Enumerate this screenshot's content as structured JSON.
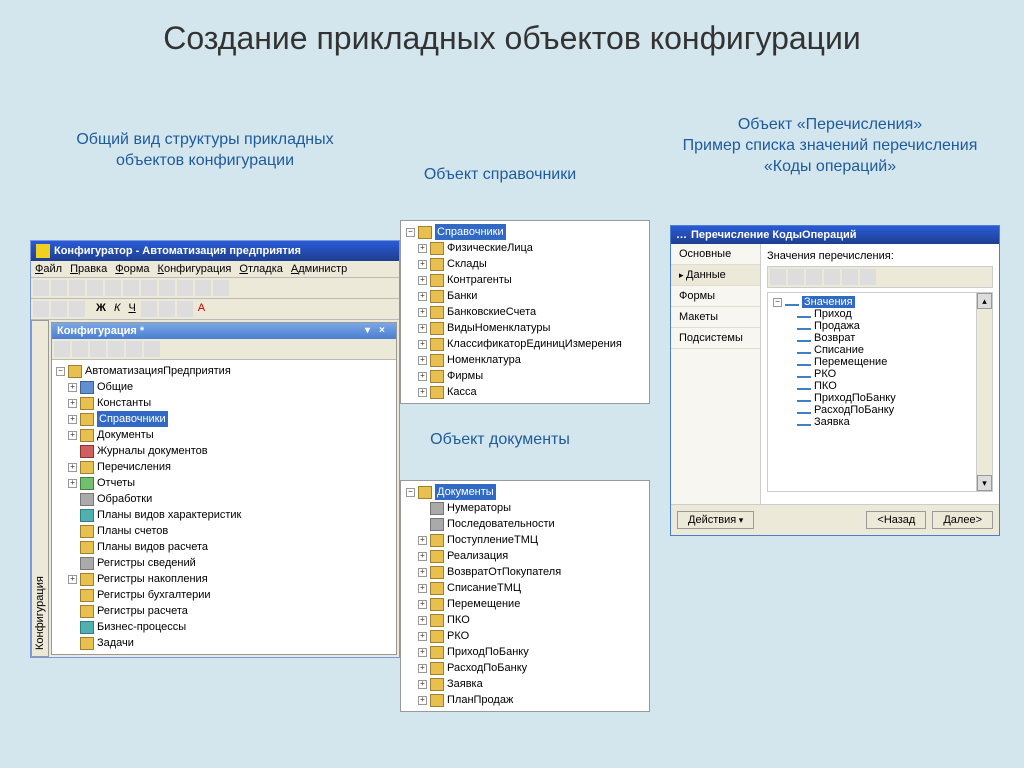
{
  "slide": {
    "title": "Создание прикладных объектов конфигурации",
    "caption1": "Общий вид структуры прикладных объектов конфигурации",
    "caption2": "Объект справочники",
    "caption3top": "Объект «Перечисления»",
    "caption3bot": "Пример списка значений перечисления «Коды операций»",
    "caption4": "Объект документы"
  },
  "configurator": {
    "title": "Конфигуратор - Автоматизация предприятия",
    "menu": [
      "Файл",
      "Правка",
      "Форма",
      "Конфигурация",
      "Отладка",
      "Администр"
    ],
    "panel_title": "Конфигурация *",
    "vtab": "Конфигурация",
    "root": "АвтоматизацияПредприятия",
    "items": [
      {
        "label": "Общие",
        "exp": "+",
        "ind": 1
      },
      {
        "label": "Константы",
        "exp": "+",
        "ind": 1
      },
      {
        "label": "Справочники",
        "exp": "+",
        "ind": 1,
        "sel": true
      },
      {
        "label": "Документы",
        "exp": "+",
        "ind": 1
      },
      {
        "label": "Журналы документов",
        "exp": "",
        "ind": 1
      },
      {
        "label": "Перечисления",
        "exp": "+",
        "ind": 1
      },
      {
        "label": "Отчеты",
        "exp": "+",
        "ind": 1
      },
      {
        "label": "Обработки",
        "exp": "",
        "ind": 1
      },
      {
        "label": "Планы видов характеристик",
        "exp": "",
        "ind": 1
      },
      {
        "label": "Планы счетов",
        "exp": "",
        "ind": 1
      },
      {
        "label": "Планы видов расчета",
        "exp": "",
        "ind": 1
      },
      {
        "label": "Регистры сведений",
        "exp": "",
        "ind": 1
      },
      {
        "label": "Регистры накопления",
        "exp": "+",
        "ind": 1
      },
      {
        "label": "Регистры бухгалтерии",
        "exp": "",
        "ind": 1
      },
      {
        "label": "Регистры расчета",
        "exp": "",
        "ind": 1
      },
      {
        "label": "Бизнес-процессы",
        "exp": "",
        "ind": 1
      },
      {
        "label": "Задачи",
        "exp": "",
        "ind": 1
      }
    ]
  },
  "refs": {
    "root": "Справочники",
    "items": [
      "ФизическиеЛица",
      "Склады",
      "Контрагенты",
      "Банки",
      "БанковскиеСчета",
      "ВидыНоменклатуры",
      "КлассификаторЕдиницИзмерения",
      "Номенклатура",
      "Фирмы",
      "Касса"
    ]
  },
  "docs": {
    "root": "Документы",
    "items": [
      "Нумераторы",
      "Последовательности",
      "ПоступлениеТМЦ",
      "Реализация",
      "ВозвратОтПокупателя",
      "СписаниеТМЦ",
      "Перемещение",
      "ПКО",
      "РКО",
      "ПриходПоБанку",
      "РасходПоБанку",
      "Заявка",
      "ПланПродаж"
    ]
  },
  "enum": {
    "title": "Перечисление КодыОпераций",
    "tabs": [
      "Основные",
      "Данные",
      "Формы",
      "Макеты",
      "Подсистемы"
    ],
    "label": "Значения перечисления:",
    "root": "Значения",
    "values": [
      "Приход",
      "Продажа",
      "Возврат",
      "Списание",
      "Перемещение",
      "РКО",
      "ПКО",
      "ПриходПоБанку",
      "РасходПоБанку",
      "Заявка"
    ],
    "buttons": {
      "actions": "Действия",
      "back": "<Назад",
      "next": "Далее>"
    }
  }
}
